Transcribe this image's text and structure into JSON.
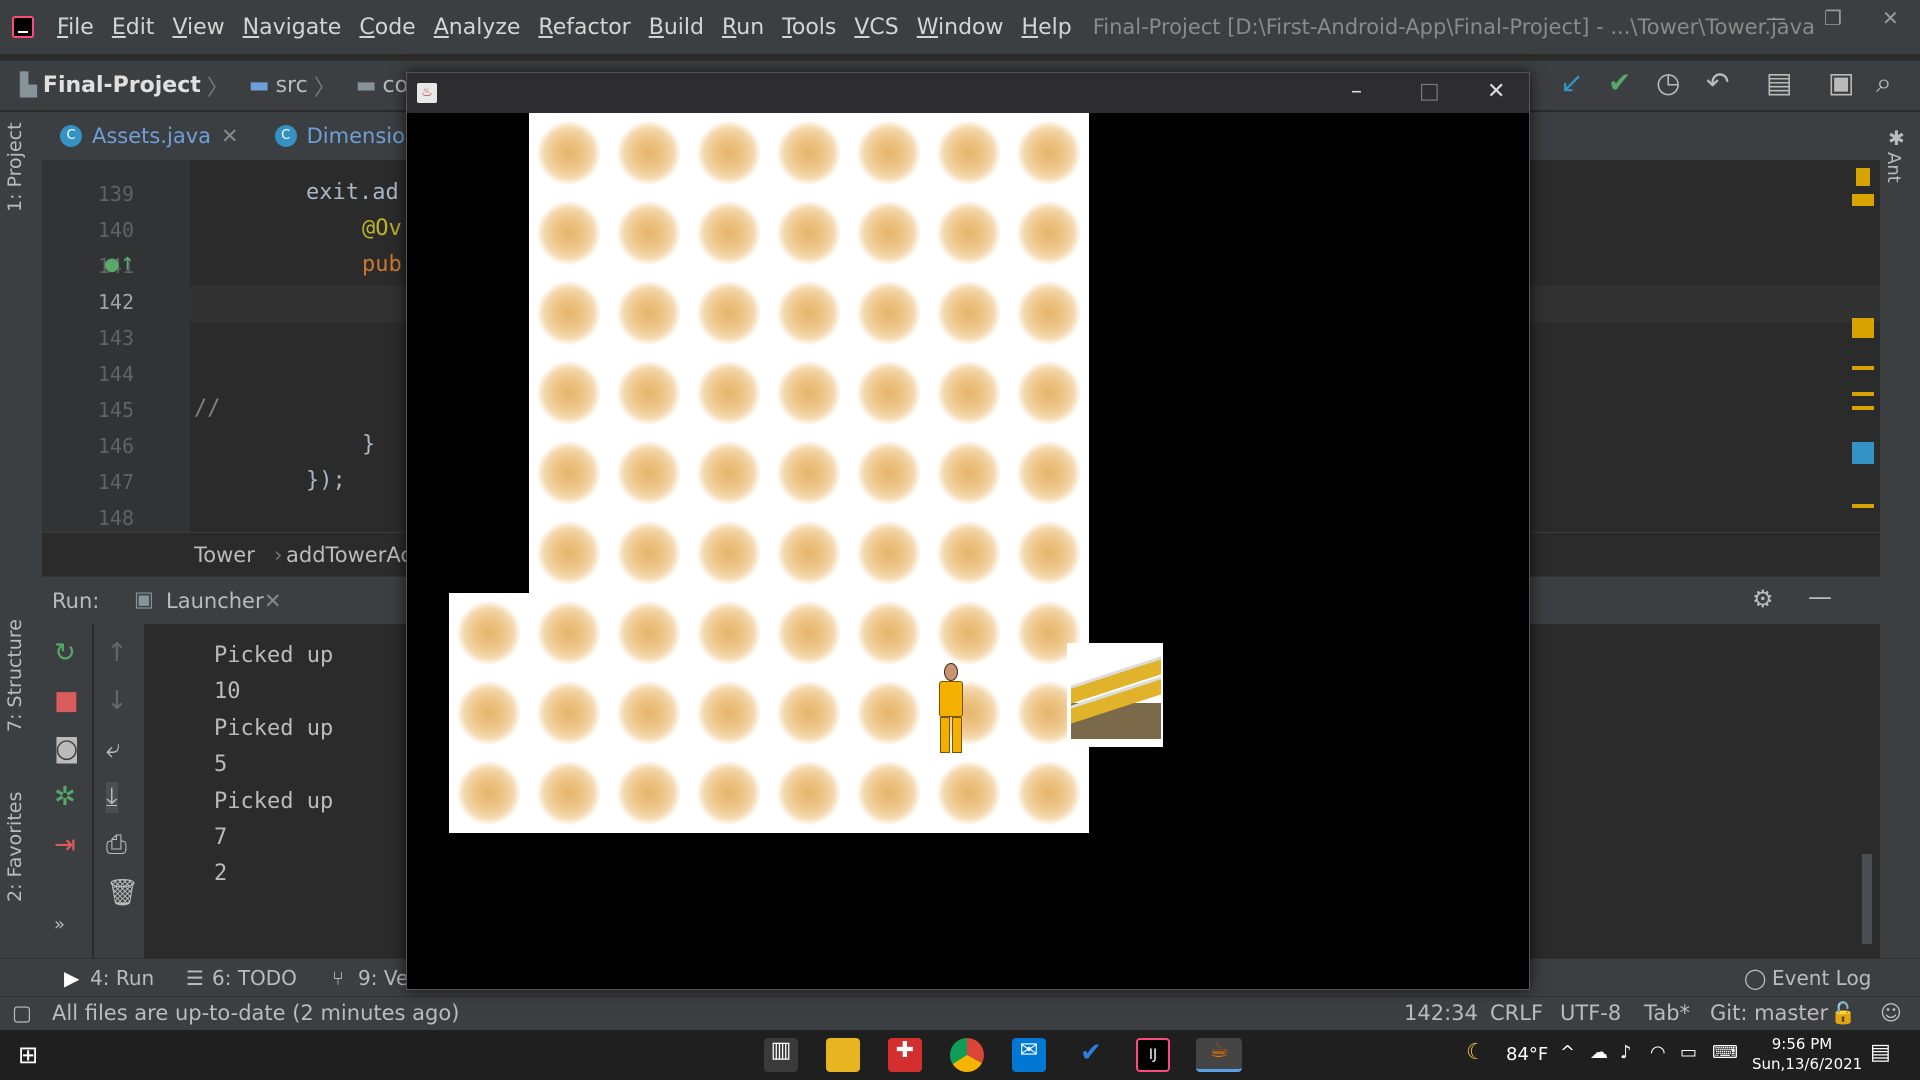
{
  "menu": {
    "items": [
      "File",
      "Edit",
      "View",
      "Navigate",
      "Code",
      "Analyze",
      "Refactor",
      "Build",
      "Run",
      "Tools",
      "VCS",
      "Window",
      "Help"
    ],
    "window_title": "Final-Project [D:\\First-Android-App\\Final-Project] - ...\\Tower\\Tower.java"
  },
  "nav": {
    "project": "Final-Project",
    "crumbs": [
      "src",
      "com"
    ]
  },
  "left_tabs": {
    "project": "1: Project",
    "structure": "7: Structure",
    "favorites": "2: Favorites"
  },
  "right_tabs": {
    "ant": "Ant"
  },
  "editor_tabs": [
    {
      "label": "Assets.java",
      "badge": "C"
    },
    {
      "label": "Dimension.ja",
      "badge": "C"
    }
  ],
  "editor": {
    "lines": [
      {
        "number": "139",
        "code": "exit.ad"
      },
      {
        "number": "140",
        "code": "@Ov"
      },
      {
        "number": "141",
        "code": "pub"
      },
      {
        "number": "142",
        "code": ""
      },
      {
        "number": "143",
        "code": ""
      },
      {
        "number": "144",
        "code": ""
      },
      {
        "number": "145",
        "code": "//"
      },
      {
        "number": "146",
        "code": "}"
      },
      {
        "number": "147",
        "code": "});"
      },
      {
        "number": "148",
        "code": ""
      }
    ],
    "breadcrumb": [
      "Tower",
      "addTowerAc"
    ]
  },
  "run": {
    "label": "Run:",
    "tab": "Launcher",
    "console": [
      "Picked up",
      "10",
      "Picked up",
      "5",
      "Picked up",
      "7",
      "2"
    ]
  },
  "bottom_tabs": {
    "run": "4: Run",
    "todo": "6: TODO",
    "vcs": "9: Ve",
    "event_log": "Event Log"
  },
  "status": {
    "message": "All files are up-to-date (2 minutes ago)",
    "position": "142:34",
    "line_sep": "CRLF",
    "encoding": "UTF-8",
    "indent": "Tab*",
    "git": "Git: master"
  },
  "taskbar": {
    "weather": "84°F",
    "time": "9:56 PM",
    "date": "Sun,13/6/2021"
  },
  "game": {
    "window_title": "",
    "sand_color": "#e6b46e",
    "player_color": "#f4b000",
    "stairs_color": "#e1b32b"
  },
  "colors": {
    "ide_bg": "#2b2b2b",
    "panel_bg": "#3c3f41",
    "accent_blue": "#3592c4"
  }
}
